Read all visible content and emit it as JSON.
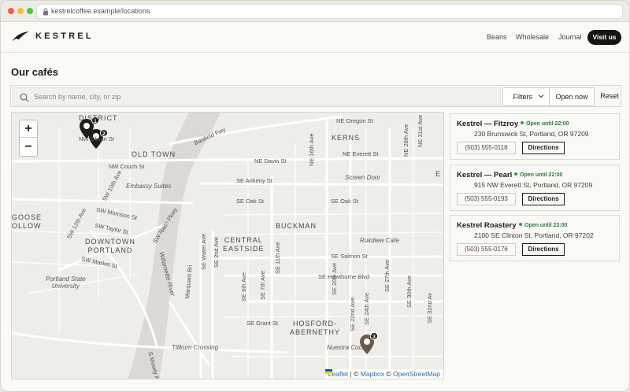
{
  "browser": {
    "url": "kestrelcoffee.example/locations"
  },
  "header": {
    "brand": "KESTREL",
    "nav": [
      "Beans",
      "Wholesale",
      "Journal"
    ],
    "cta": "Visit us"
  },
  "page": {
    "title": "Our cafés"
  },
  "search": {
    "placeholder": "Search by name, city, or zip",
    "filters_label": "Filters",
    "open_now_label": "Open now",
    "reset_label": "Reset"
  },
  "map": {
    "zoom_in": "+",
    "zoom_out": "−",
    "attribution": {
      "leaflet": "Leaflet",
      "sep1": " | © ",
      "mapbox": "Mapbox",
      "sep2": " © ",
      "osm": "OpenStreetMap"
    },
    "markers": [
      "1",
      "2",
      "3"
    ],
    "labels": {
      "district": "DISTRICT",
      "old_town": "OLD TOWN",
      "kerns": "KERNS",
      "buckman": "BUCKMAN",
      "central_eastside": "CENTRAL\nEASTSIDE",
      "downtown": "DOWNTOWN\nPORTLAND",
      "hosford": "HOSFORD-\nABERNETHY",
      "goose": "GOOSE\nOLLOW",
      "nw_glisan": "NW Glisan St",
      "nw_couch": "NW Couch St",
      "embassy": "Embassy Suites",
      "sw_morrison": "SW Morrison St",
      "sw_taylor": "SW Taylor St",
      "sw_12th": "SW 12th Ave",
      "sw_10th": "SW 10th Ave",
      "sw_market": "SW Market St",
      "sw_naito": "SW Naito Pkwy",
      "psu": "Portland State\nUniversity",
      "willamette": "Willamette River",
      "marquam": "Marquam Bri",
      "tilikum": "Tilikum Crossing",
      "sw_moody": "S Moody A",
      "banfield": "Banfield Fwy",
      "ne_oregon": "NE Oregon St",
      "ne_davis": "NE Davis St",
      "ne_everett": "NE Everett St",
      "se_ankeny": "SE Ankeny St",
      "screen_door": "Screen Door",
      "se_oak_w": "SE Oak St",
      "se_oak_e": "SE Oak St",
      "se_salmon": "SE Salmon St",
      "se_hawthorne": "SE Hawthorne Blvd",
      "se_grant": "SE Grant St",
      "rukdiew": "Rukdiew Cafe",
      "nuestra": "Nuestra Cocina",
      "se_water": "SE Water Ave",
      "se_2nd": "SE 2nd Ave",
      "se_6th": "SE 6th Ave",
      "se_7th": "SE 7th Ave",
      "se_11th": "SE 11th Ave",
      "ne_16th": "NE 16th Ave",
      "ne_28th": "NE 28th Ave",
      "ne_31st": "NE 31st Ave",
      "se_20th": "SE 20th Ave",
      "se_22nd": "SE 22nd Ave",
      "se_24th": "SE 24th Ave",
      "se_27th": "SE 27th Ave",
      "se_30th": "SE 30th Ave",
      "se_32nd": "SE 32nd Av",
      "ne_e": "E E"
    }
  },
  "locations": [
    {
      "name": "Kestrel — Fitzroy",
      "status": "Open until 22:00",
      "address": "230 Brunswick St, Portland, OR 97209",
      "phone": "(503) 555-0118",
      "directions": "Directions"
    },
    {
      "name": "Kestrel — Pearl",
      "status": "Open until 22:00",
      "address": "915 NW Everett St, Portland, OR 97209",
      "phone": "(503) 555-0193",
      "directions": "Directions"
    },
    {
      "name": "Kestrel Roastery",
      "status": "Open until 22:00",
      "address": "2100 SE Clinton St, Portland, OR 97202",
      "phone": "(503) 555-0176",
      "directions": "Directions"
    }
  ],
  "colors": {
    "accent": "#15140f",
    "open_status": "#2f7a3e",
    "roastery_pin": "#6b5a4a",
    "river": "#dcd9d4"
  }
}
